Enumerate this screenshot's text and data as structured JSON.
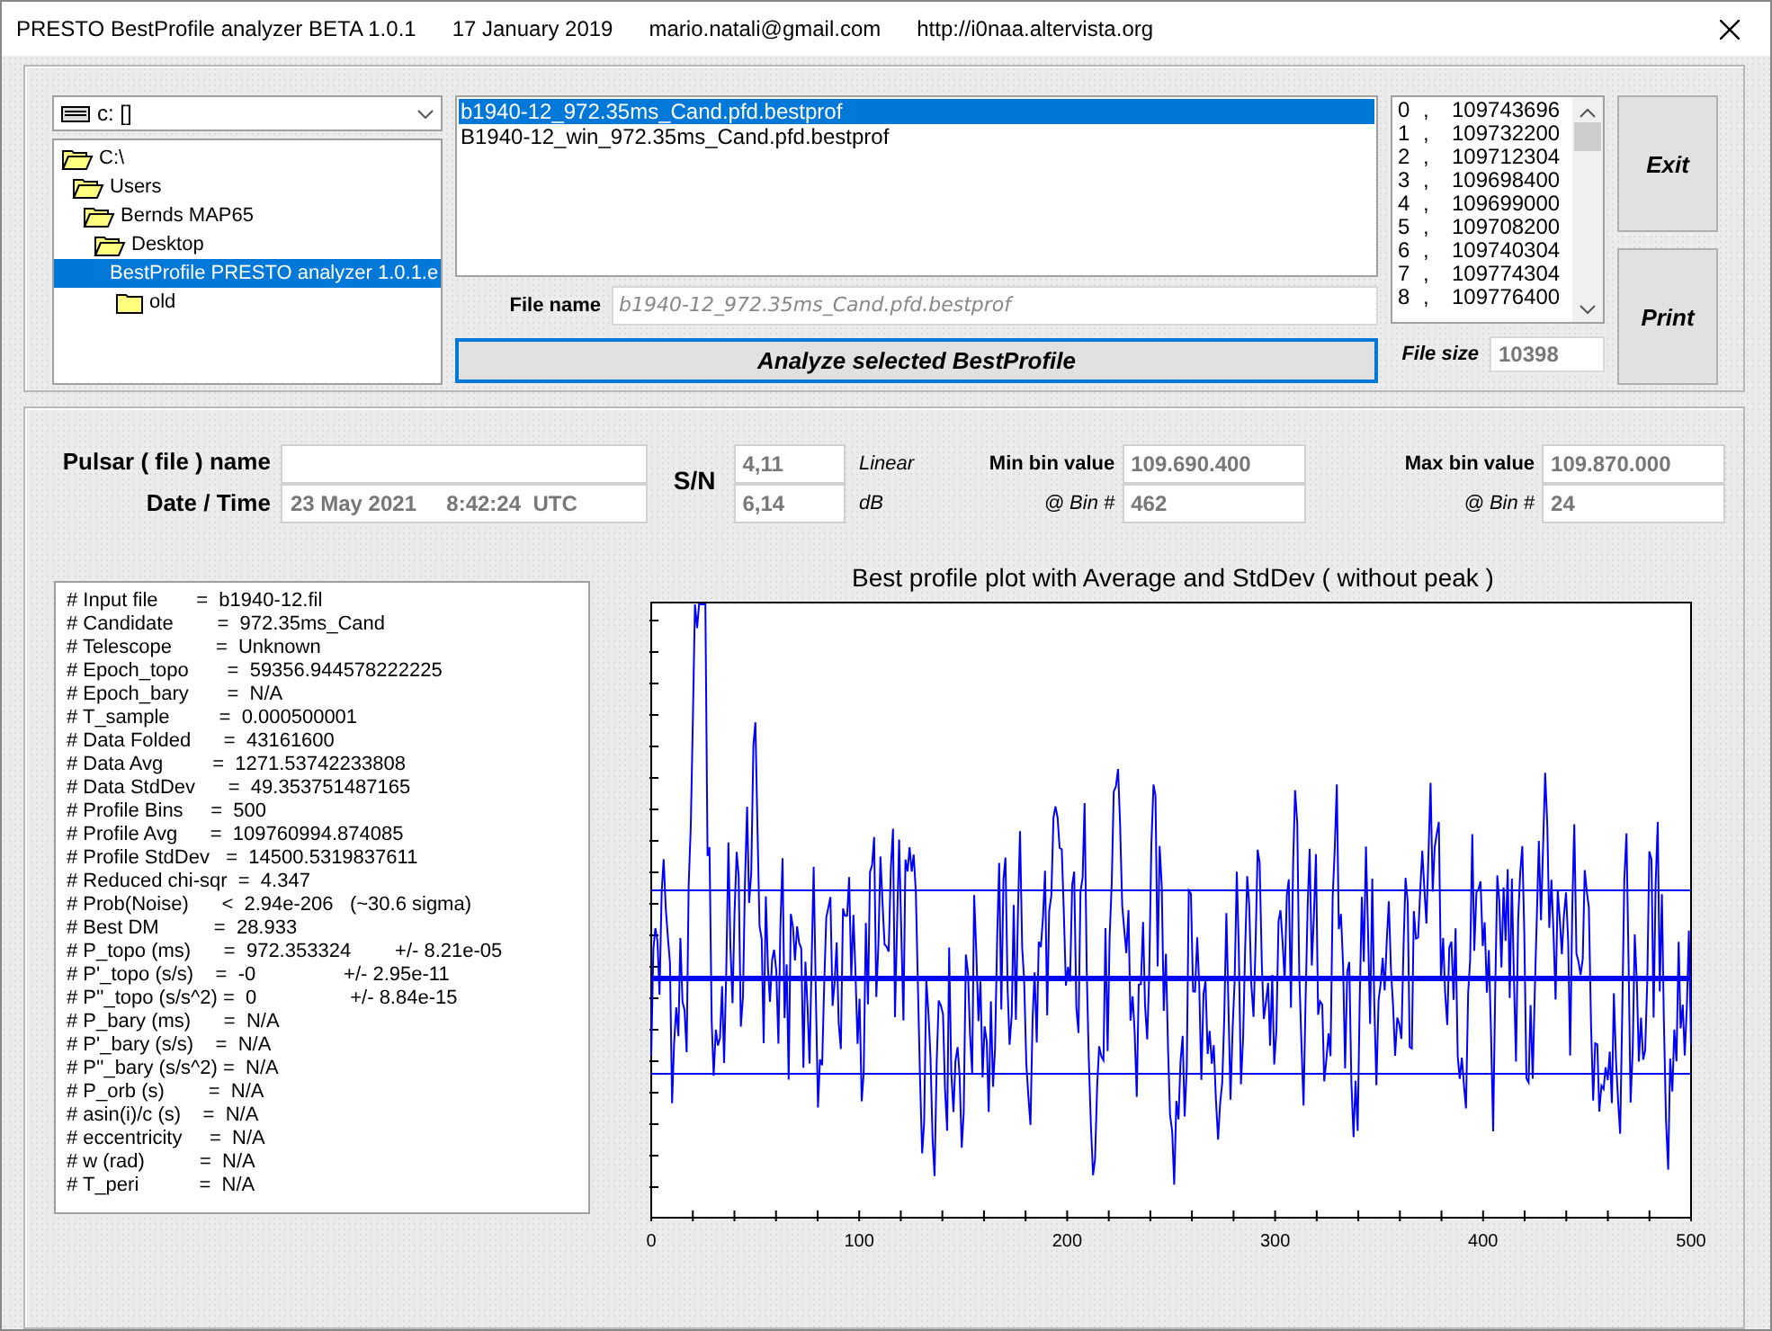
{
  "window": {
    "title_parts": [
      "PRESTO BestProfile analyzer BETA 1.0.1",
      "17 January 2019",
      "mario.natali@gmail.com",
      "http://i0naa.altervista.org"
    ]
  },
  "drive_select": {
    "value": "c: []"
  },
  "folder_tree": [
    {
      "label": "C:\\",
      "selected": false,
      "children": [
        {
          "label": "Users",
          "selected": false,
          "children": [
            {
              "label": "Bernds MAP65",
              "selected": false,
              "children": [
                {
                  "label": "Desktop",
                  "selected": false,
                  "children": [
                    {
                      "label": "BestProfile PRESTO analyzer 1.0.1.e",
                      "selected": true,
                      "children": [
                        {
                          "label": "old",
                          "selected": false
                        }
                      ]
                    }
                  ]
                }
              ]
            }
          ]
        }
      ]
    }
  ],
  "files": [
    {
      "name": "b1940-12_972.35ms_Cand.pfd.bestprof",
      "selected": true
    },
    {
      "name": "B1940-12_win_972.35ms_Cand.pfd.bestprof",
      "selected": false
    }
  ],
  "file_name": {
    "label": "File name",
    "value": "b1940-12_972.35ms_Cand.pfd.bestprof"
  },
  "analyze_button": "Analyze selected BestProfile",
  "bins": [
    {
      "index": "0",
      "sep": ",",
      "value": "109743696"
    },
    {
      "index": "1",
      "sep": ",",
      "value": "109732200"
    },
    {
      "index": "2",
      "sep": ",",
      "value": "109712304"
    },
    {
      "index": "3",
      "sep": ",",
      "value": "109698400"
    },
    {
      "index": "4",
      "sep": ",",
      "value": "109699000"
    },
    {
      "index": "5",
      "sep": ",",
      "value": "109708200"
    },
    {
      "index": "6",
      "sep": ",",
      "value": "109740304"
    },
    {
      "index": "7",
      "sep": ",",
      "value": "109774304"
    },
    {
      "index": "8",
      "sep": ",",
      "value": "109776400"
    }
  ],
  "file_size": {
    "label": "File size",
    "value": "10398"
  },
  "buttons": [
    "Exit",
    "Print"
  ],
  "pulsar": {
    "name_label": "Pulsar ( file ) name",
    "date_label": "Date / Time",
    "date_value": "23 May 2021     8:42:24  UTC"
  },
  "sn": {
    "label": "S/N",
    "linear": "4,11",
    "linear_unit": "Linear",
    "db": "6,14",
    "db_unit": "dB"
  },
  "min_bin": {
    "label": "Min bin value",
    "value": "109.690.400",
    "bin_label": "@ Bin #",
    "bin": "462"
  },
  "max_bin": {
    "label": "Max bin value",
    "value": "109.870.000",
    "bin_label": "@ Bin #",
    "bin": "24"
  },
  "info_lines": [
    "# Input file       =  b1940-12.fil",
    "# Candidate        =  972.35ms_Cand",
    "# Telescope        =  Unknown",
    "# Epoch_topo       =  59356.944578222225",
    "# Epoch_bary       =  N/A",
    "# T_sample         =  0.000500001",
    "# Data Folded      =  43161600",
    "# Data Avg         =  1271.53742233808",
    "# Data StdDev      =  49.353751487165",
    "# Profile Bins     =  500",
    "# Profile Avg      =  109760994.874085",
    "# Profile StdDev   =  14500.5319837611",
    "# Reduced chi-sqr  =  4.347",
    "# Prob(Noise)      <  2.94e-206   (~30.6 sigma)",
    "# Best DM          =  28.933",
    "# P_topo (ms)      =  972.353324        +/- 8.21e-05",
    "# P'_topo (s/s)    =  -0                +/- 2.95e-11",
    "# P''_topo (s/s^2) =  0                 +/- 8.84e-15",
    "# P_bary (ms)      =  N/A",
    "# P'_bary (s/s)    =  N/A",
    "# P''_bary (s/s^2) =  N/A",
    "# P_orb (s)        =  N/A",
    "# asin(i)/c (s)    =  N/A",
    "# eccentricity     =  N/A",
    "# w (rad)          =  N/A",
    "# T_peri           =  N/A"
  ],
  "plot": {
    "title": "Best profile plot with  Average and StdDev ( without peak )",
    "x_tick_labels": [
      "0",
      "100",
      "200",
      "300",
      "400",
      "500"
    ]
  }
}
